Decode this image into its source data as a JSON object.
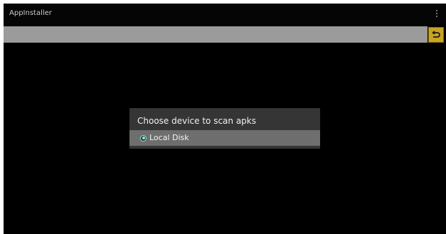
{
  "app": {
    "title": "AppInstaller"
  },
  "icons": {
    "overflow_menu": "overflow-menu-icon",
    "back": "back-arrow-icon",
    "radio_selected": "radio-selected-icon"
  },
  "path_bar": {
    "value": ""
  },
  "dialog": {
    "title": "Choose device to scan apks",
    "options": [
      {
        "label": "Local Disk",
        "selected": true
      }
    ]
  },
  "colors": {
    "background": "#000000",
    "path_bar": "#9b9b9b",
    "back_button": "#c9a322",
    "dialog": "#353535",
    "option_row": "#6e6e6e",
    "radio_accent": "#8fe8e4"
  }
}
